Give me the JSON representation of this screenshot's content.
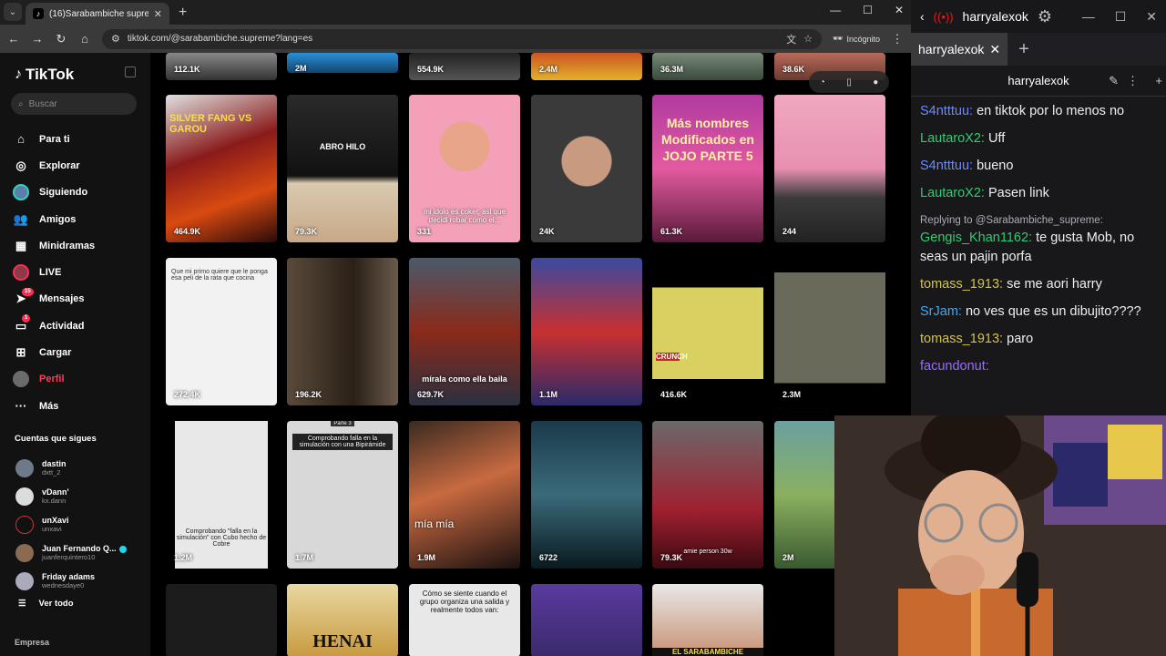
{
  "browser": {
    "tab_title": "(16)Sarabambiche supreme (@",
    "tab_favicon": "tiktok-icon",
    "url": "tiktok.com/@sarabambiche.supreme?lang=es",
    "incognito_label": "Incógnito"
  },
  "tiktok": {
    "logo": "TikTok",
    "search_placeholder": "Buscar",
    "nav": [
      {
        "label": "Para ti",
        "icon": "home-icon"
      },
      {
        "label": "Explorar",
        "icon": "compass-icon"
      },
      {
        "label": "Siguiendo",
        "icon": "following-avatar-icon"
      },
      {
        "label": "Amigos",
        "icon": "friends-icon"
      },
      {
        "label": "Minidramas",
        "icon": "film-icon"
      },
      {
        "label": "LIVE",
        "icon": "live-icon"
      },
      {
        "label": "Mensajes",
        "icon": "paper-plane-icon",
        "badge": "15"
      },
      {
        "label": "Actividad",
        "icon": "inbox-icon",
        "badge": "1"
      },
      {
        "label": "Cargar",
        "icon": "plus-square-icon"
      },
      {
        "label": "Perfil",
        "icon": "profile-avatar-icon"
      },
      {
        "label": "Más",
        "icon": "more-dots-icon"
      }
    ],
    "following_header": "Cuentas que sigues",
    "following": [
      {
        "name": "dastin",
        "user": "dxtt_2"
      },
      {
        "name": "vDann'",
        "user": "kx.dann"
      },
      {
        "name": "unXavi",
        "user": "unxavi"
      },
      {
        "name": "Juan Fernando Q...",
        "user": "juanferquintero10"
      },
      {
        "name": "Friday adams",
        "user": "wednesdaye0"
      }
    ],
    "see_all": "Ver todo",
    "footer": "Empresa"
  },
  "grid": {
    "row0": [
      "112.1K",
      "2M",
      "554.9K",
      "2.4M",
      "36.3M",
      "38.6K"
    ],
    "row1": [
      {
        "count": "464.9K",
        "caption": "SILVER FANG VS GAROU"
      },
      {
        "count": "79.3K",
        "caption": "ABRO HILO"
      },
      {
        "count": "331",
        "caption": "mi idolo es coker, asi que decidi robar como el..."
      },
      {
        "count": "24K",
        "caption": ""
      },
      {
        "count": "61.3K",
        "caption": "Más nombres Modificados en JOJO PARTE 5"
      },
      {
        "count": "244",
        "caption": ""
      }
    ],
    "row2": [
      {
        "count": "272.4K",
        "caption": "Que mi primo quiere que le ponga esa peli de la rata que cocina"
      },
      {
        "count": "196.2K",
        "caption": ""
      },
      {
        "count": "629.7K",
        "caption": "mírala como ella baila"
      },
      {
        "count": "1.1M",
        "caption": ""
      },
      {
        "count": "416.6K",
        "caption": "CRUNCH"
      },
      {
        "count": "2.3M",
        "caption": ""
      }
    ],
    "row3": [
      {
        "count": "1.2M",
        "caption": "Comprobando \"falla en la simulación\" con Cubo hecho de Cobre"
      },
      {
        "count": "1.7M",
        "caption": "Comprobando falla en la simulación con una Bipirámide"
      },
      {
        "count": "1.9M",
        "caption": "mía mía"
      },
      {
        "count": "6722",
        "caption": ""
      },
      {
        "count": "79.3K",
        "caption": "amie person 30w"
      },
      {
        "count": "2M",
        "caption": ""
      }
    ],
    "row4": [
      {
        "caption": ""
      },
      {
        "caption": "HENAI"
      },
      {
        "caption": "Cómo se siente cuando el grupo organiza una salida y realmente todos van:"
      },
      {
        "caption": ""
      },
      {
        "caption": "EL SARABAMBICHE"
      }
    ],
    "row3_label": "Parte 3"
  },
  "chat": {
    "channel": "harryalexok",
    "tab": "harryalexok",
    "header": "harryalexok",
    "messages": [
      {
        "user": "S4ntttuu:",
        "color": "#6a8bff",
        "text": "en tiktok por lo menos no"
      },
      {
        "user": "LautaroX2:",
        "color": "#2ecc71",
        "text": "Uff"
      },
      {
        "user": "S4ntttuu:",
        "color": "#6a8bff",
        "text": "bueno"
      },
      {
        "user": "LautaroX2:",
        "color": "#2ecc71",
        "text": "Pasen link"
      },
      {
        "reply": "Replying to @Sarabambiche_supreme:",
        "user": "Gengis_Khan1162:",
        "color": "#2ecc71",
        "text": "te gusta Mob, no seas un pajin porfa"
      },
      {
        "user": "tomass_1913:",
        "color": "#d4c24a",
        "text": "se me aori harry"
      },
      {
        "user": "SrJam:",
        "color": "#3fa9f5",
        "text": "no ves que es un dibujito????"
      },
      {
        "user": "tomass_1913:",
        "color": "#d4c24a",
        "text": "paro"
      },
      {
        "user": "facundonut:",
        "color": "#9a6bff",
        "text": ""
      }
    ]
  }
}
